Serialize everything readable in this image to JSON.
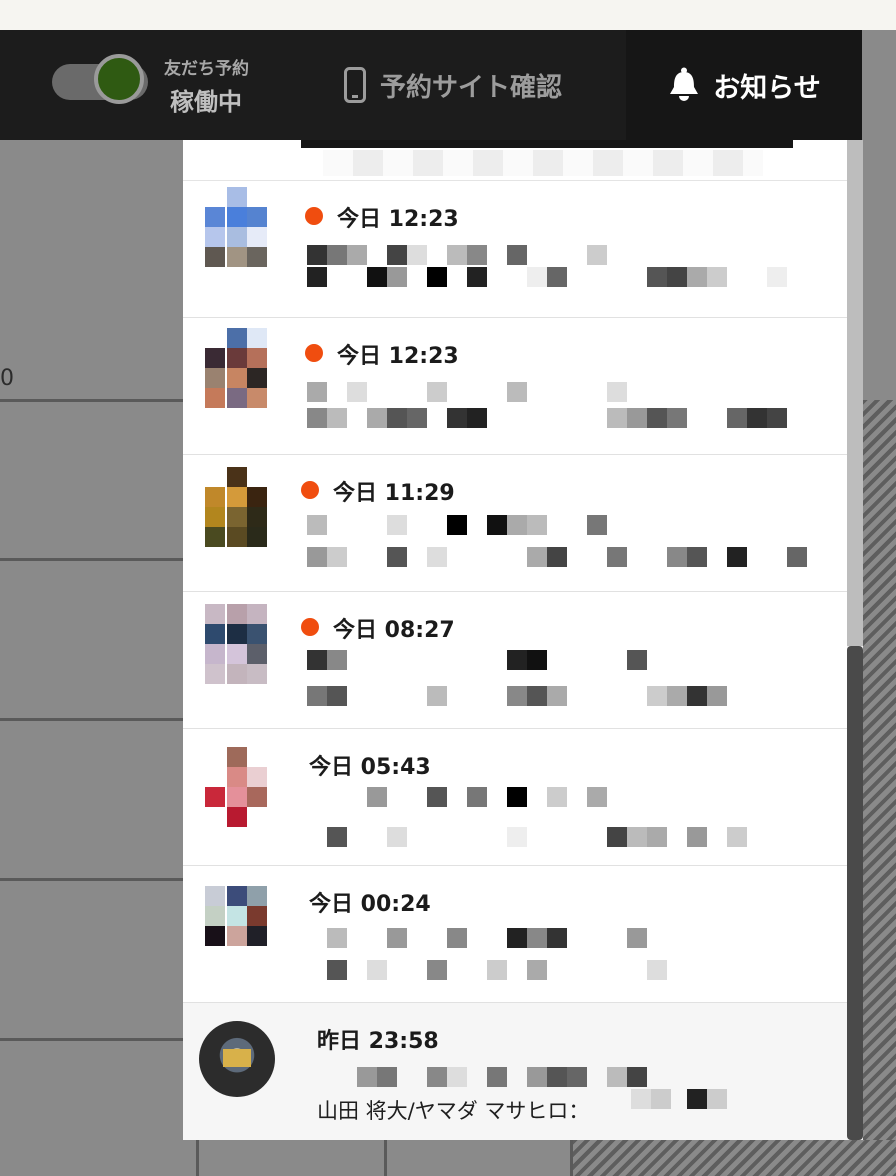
{
  "header": {
    "toggle_sub_label": "友だち予約",
    "toggle_status": "稼働中",
    "toggle_on": true,
    "site_link_label": "予約サイト確認",
    "notice_label": "お知らせ"
  },
  "background": {
    "edge_text": "0"
  },
  "notifications": [
    {
      "time": "今日 12:23",
      "unread": true
    },
    {
      "time": "今日 12:23",
      "unread": true
    },
    {
      "time": "今日 11:29",
      "unread": true
    },
    {
      "time": "今日 08:27",
      "unread": true
    },
    {
      "time": "今日 05:43",
      "unread": false
    },
    {
      "time": "今日 00:24",
      "unread": false
    },
    {
      "time": "昨日 23:58",
      "unread": false,
      "name_text": "山田 将大/ヤマダ マサヒロ："
    }
  ],
  "colors": {
    "unread_dot": "#f04d0f",
    "header_bg": "#1c1c1c",
    "toggle_knob": "#2f5a12"
  },
  "icons": {
    "site_link": "phone-icon",
    "notice": "bell-icon"
  }
}
